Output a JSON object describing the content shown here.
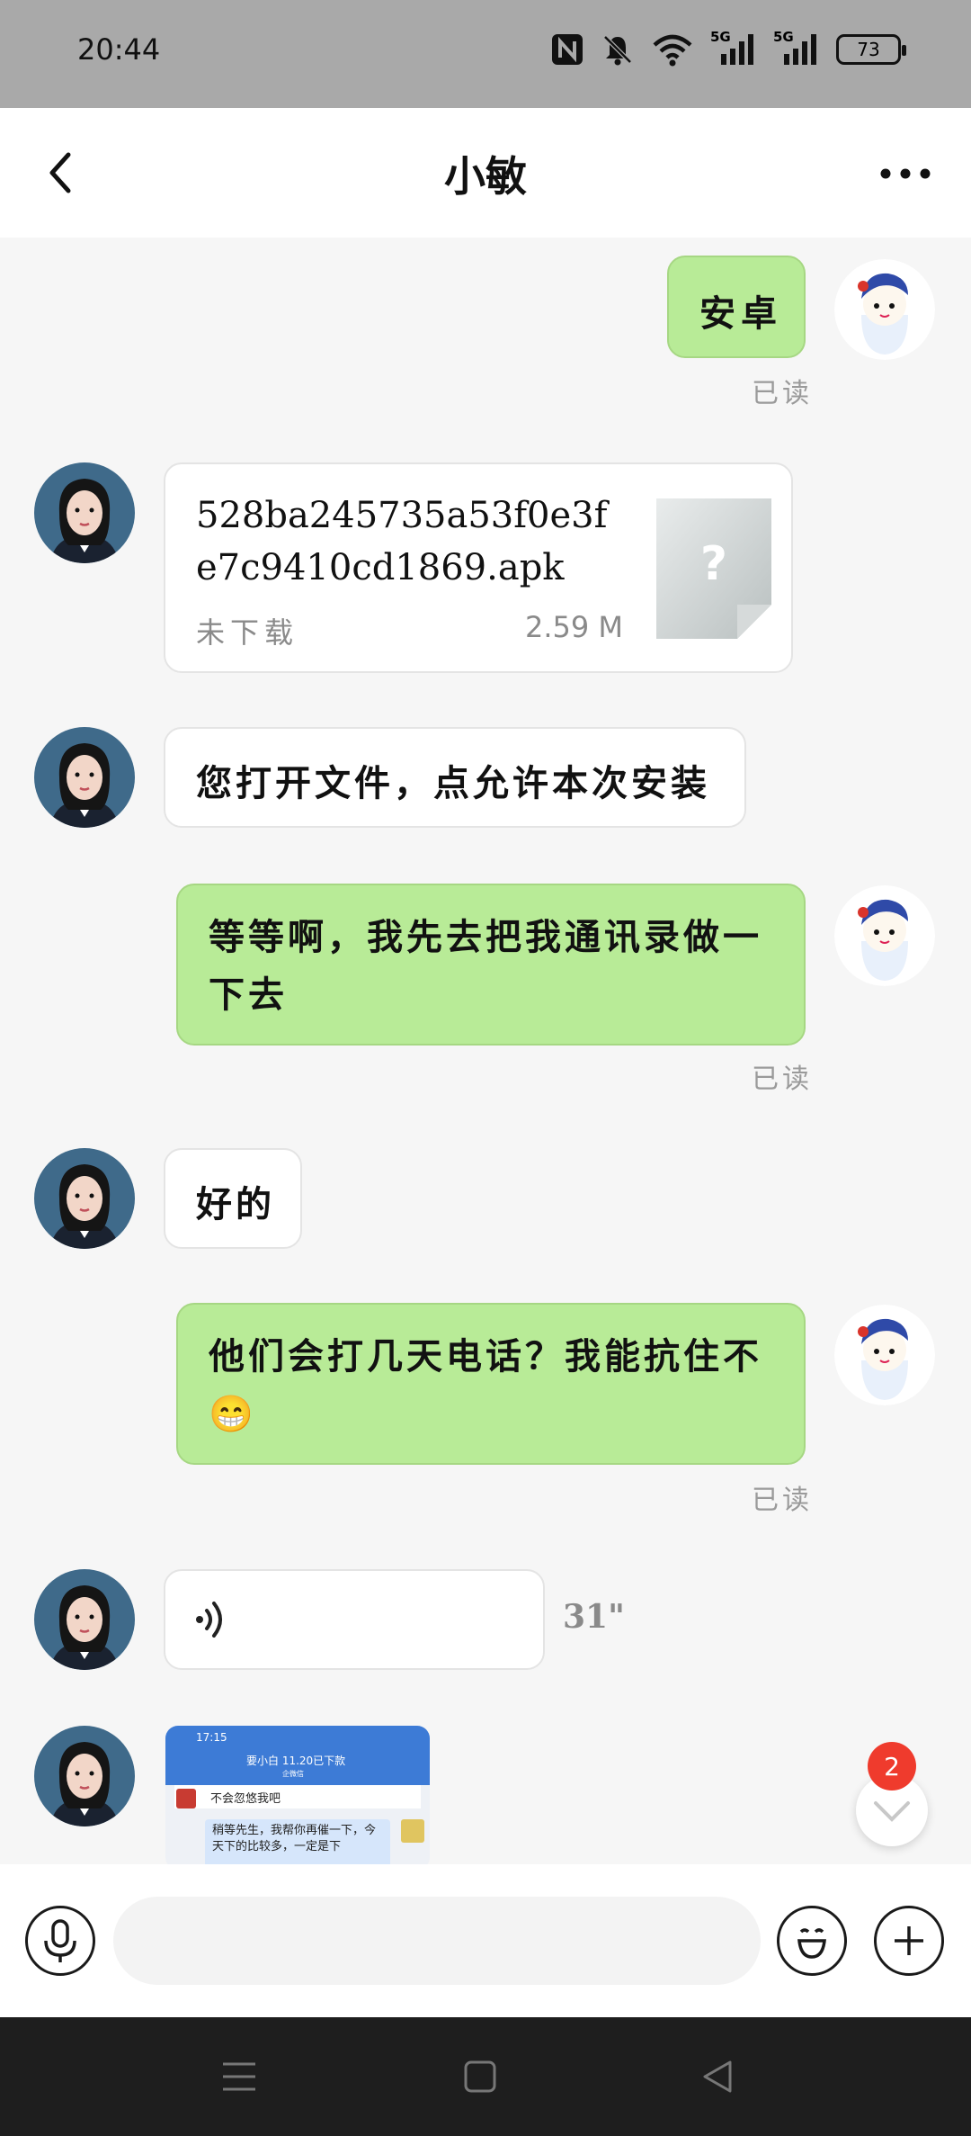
{
  "status_bar": {
    "time": "20:44",
    "network_1": "5G",
    "network_2": "5G",
    "battery": "73",
    "icons": [
      "nfc-icon",
      "mute-icon",
      "wifi-icon",
      "signal-icon",
      "signal-icon",
      "battery-icon"
    ]
  },
  "header": {
    "title": "小敏",
    "back_icon": "chevron-left-icon",
    "more_icon": "more-horizontal-icon"
  },
  "messages": [
    {
      "side": "right",
      "type": "text",
      "text": "安卓",
      "status": "已读"
    },
    {
      "side": "left",
      "type": "file",
      "file_name": "528ba245735a53f0e3fe7c9410cd1869.apk",
      "file_status": "未下载",
      "file_size": "2.59 M"
    },
    {
      "side": "left",
      "type": "text",
      "text": "您打开文件，点允许本次安装"
    },
    {
      "side": "right",
      "type": "text",
      "text": "等等啊，我先去把我通讯录做一下去",
      "status": "已读"
    },
    {
      "side": "left",
      "type": "text",
      "text": "好的"
    },
    {
      "side": "right",
      "type": "text",
      "text": "他们会打几天电话？我能抗住不😁",
      "status": "已读"
    },
    {
      "side": "left",
      "type": "voice",
      "duration": "31\""
    },
    {
      "side": "left",
      "type": "image",
      "thumb": {
        "time": "17:15",
        "title": "要小白 11.20已下款",
        "subtitle": "企微信",
        "line1": "不会忽悠我吧",
        "line2": "稍等先生，我帮你再催一下，今天下的比较多，一定是",
        "line3": "下"
      }
    }
  ],
  "unread_badge": "2",
  "input_bar": {
    "placeholder": "",
    "voice_icon": "microphone-icon",
    "emoji_icon": "emoji-icon",
    "add_icon": "plus-icon"
  },
  "system_nav": {
    "icons": [
      "menu-icon",
      "home-icon",
      "back-triangle-icon"
    ]
  }
}
